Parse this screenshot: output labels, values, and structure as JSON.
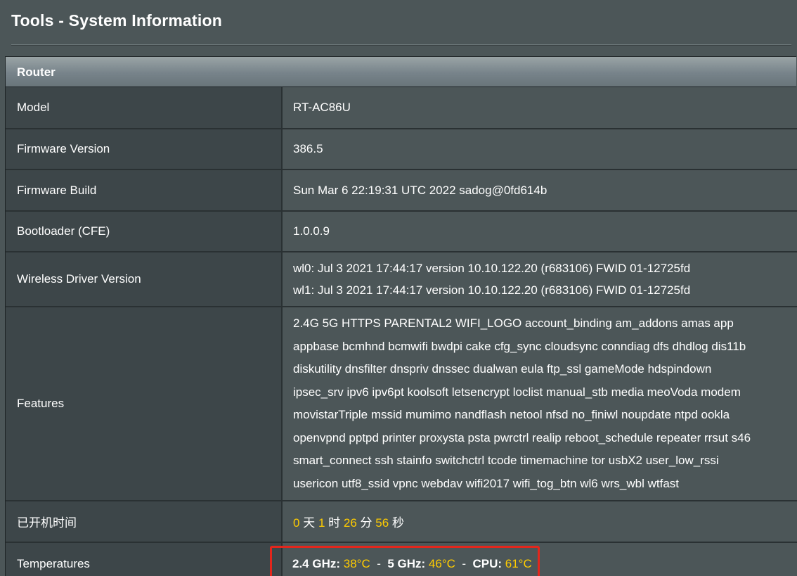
{
  "page": {
    "title": "Tools - System Information"
  },
  "panel": {
    "header": "Router"
  },
  "rows": {
    "model": {
      "label": "Model",
      "value": "RT-AC86U"
    },
    "firmware_version": {
      "label": "Firmware Version",
      "value": "386.5"
    },
    "firmware_build": {
      "label": "Firmware Build",
      "value": "Sun Mar 6 22:19:31 UTC 2022 sadog@0fd614b"
    },
    "bootloader": {
      "label": "Bootloader (CFE)",
      "value": "1.0.0.9"
    },
    "wireless_driver": {
      "label": "Wireless Driver Version",
      "lines": [
        "wl0: Jul 3 2021 17:44:17 version 10.10.122.20 (r683106) FWID 01-12725fd",
        "wl1: Jul 3 2021 17:44:17 version 10.10.122.20 (r683106) FWID 01-12725fd"
      ]
    },
    "features": {
      "label": "Features",
      "lines": [
        "2.4G 5G HTTPS PARENTAL2 WIFI_LOGO account_binding am_addons amas app",
        "appbase bcmhnd bcmwifi bwdpi cake cfg_sync cloudsync conndiag dfs dhdlog dis11b",
        "diskutility dnsfilter dnspriv dnssec dualwan eula ftp_ssl gameMode hdspindown",
        "ipsec_srv ipv6 ipv6pt koolsoft letsencrypt loclist manual_stb media meoVoda modem",
        "movistarTriple mssid mumimo nandflash netool nfsd no_finiwl noupdate ntpd ookla",
        "openvpnd pptpd printer proxysta psta pwrctrl realip reboot_schedule repeater rrsut s46",
        "smart_connect ssh stainfo switchctrl tcode timemachine tor usbX2 user_low_rssi",
        "usericon utf8_ssid vpnc webdav wifi2017 wifi_tog_btn wl6 wrs_wbl wtfast"
      ]
    },
    "uptime": {
      "label": "已开机时间",
      "days": "0",
      "days_unit": "天",
      "hours": "1",
      "hours_unit": "时",
      "minutes": "26",
      "minutes_unit": "分",
      "seconds": "56",
      "seconds_unit": "秒"
    },
    "temperatures": {
      "label": "Temperatures",
      "band24_label": "2.4 GHz:",
      "band24_value": "38°C",
      "band5_label": "5 GHz:",
      "band5_value": "46°C",
      "cpu_label": "CPU:",
      "cpu_value": "61°C",
      "separator": "-"
    }
  },
  "colors": {
    "background": "#4c5658",
    "label_cell": "#3d4649",
    "highlight_number": "#ffcc00",
    "highlight_box": "#e3261c"
  }
}
